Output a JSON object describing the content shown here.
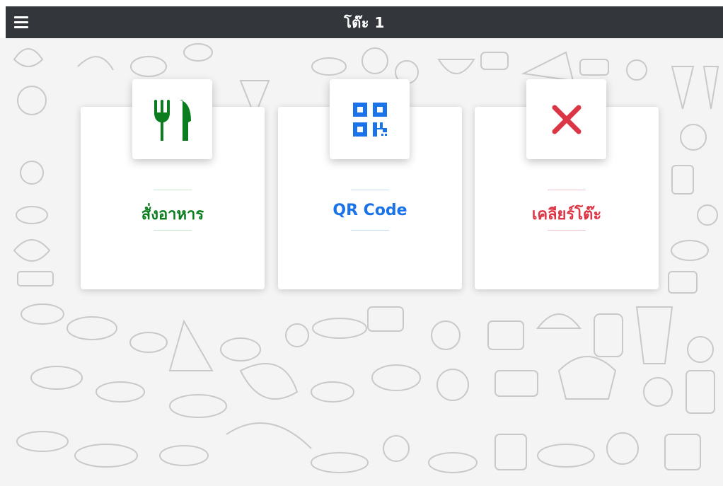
{
  "header": {
    "title": "โต๊ะ 1",
    "menu_icon": "hamburger-menu-icon"
  },
  "cards": [
    {
      "label": "สั่งอาหาร",
      "icon": "fork-knife-icon",
      "color": "#0b7d1e"
    },
    {
      "label": "QR Code",
      "icon": "qr-code-icon",
      "color": "#1a73e8"
    },
    {
      "label": "เคลียร์โต๊ะ",
      "icon": "close-x-icon",
      "color": "#dc3545"
    }
  ],
  "colors": {
    "header_bg": "#33373c",
    "background": "#f4f4f4"
  }
}
